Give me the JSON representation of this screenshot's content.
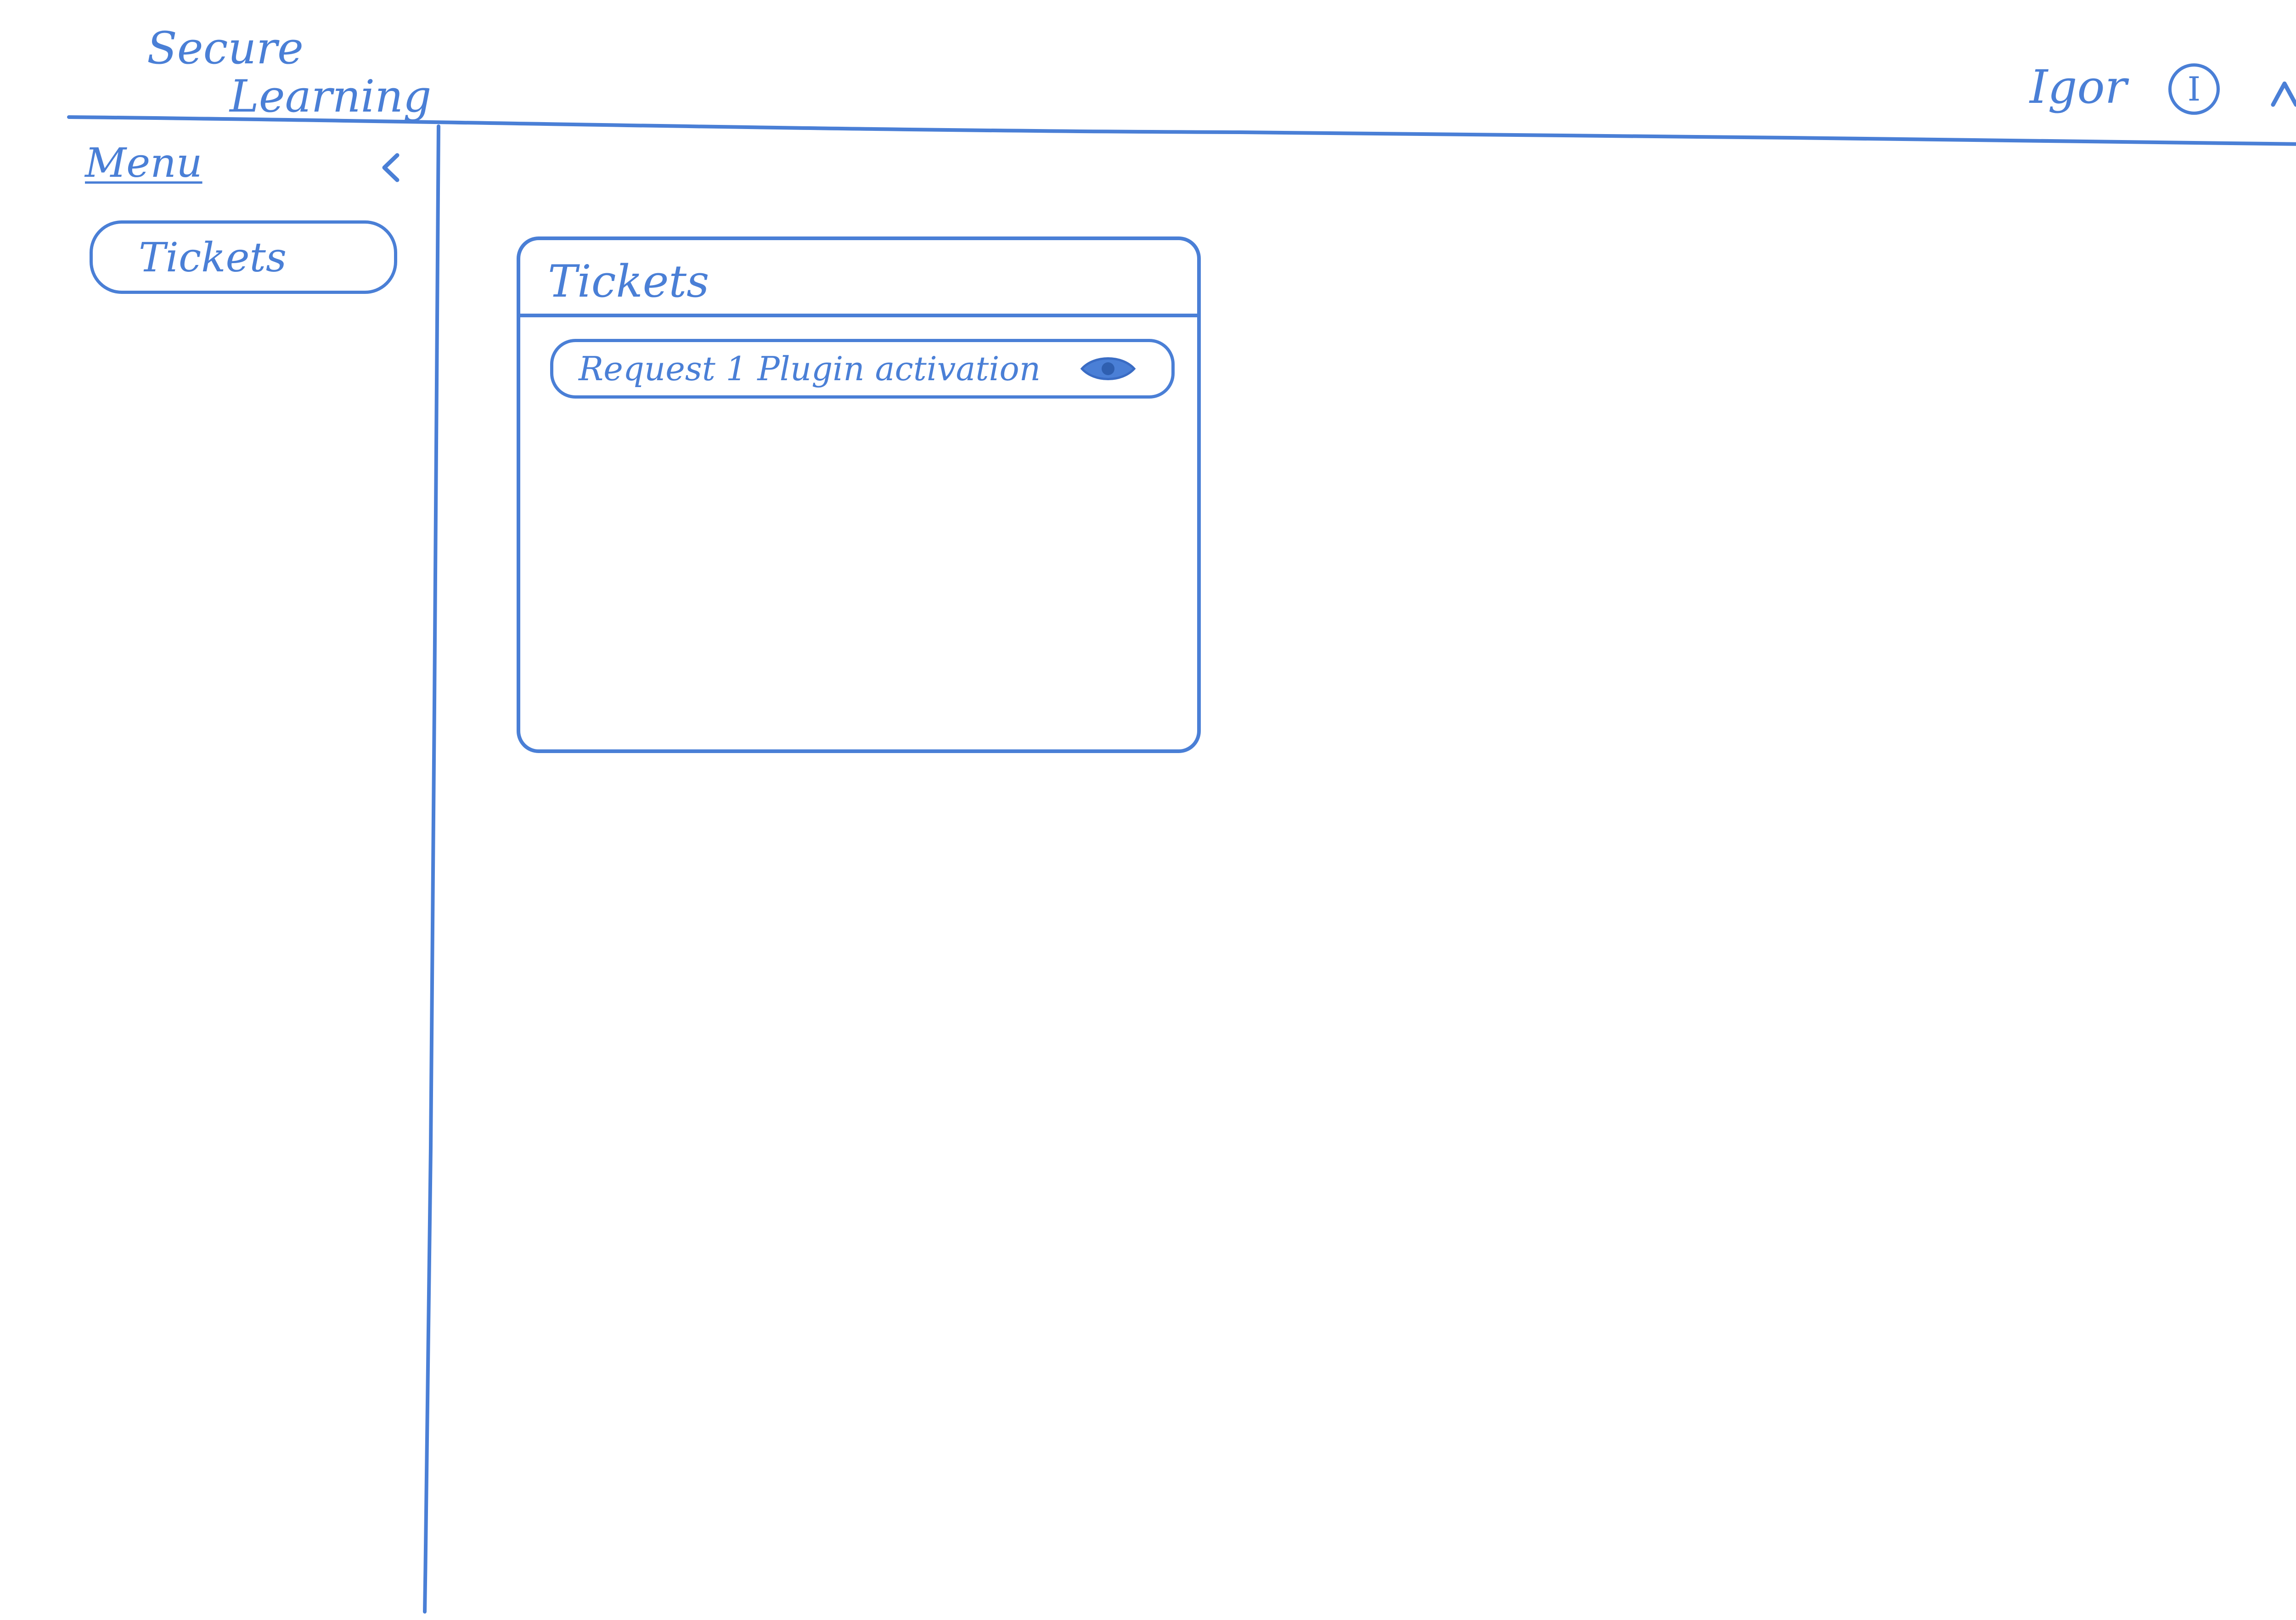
{
  "header": {
    "logo_line1": "Secure",
    "logo_line2": "Learning",
    "user_name": "Igor",
    "user_avatar_letter": "I",
    "user_menu_icon": "chevron-up-icon"
  },
  "sidebar": {
    "menu_label": "Menu",
    "collapse_icon": "chevron-left-icon",
    "items": [
      {
        "label": "Tickets"
      }
    ]
  },
  "main": {
    "tickets_panel": {
      "title": "Tickets",
      "rows": [
        {
          "label": "Request 1 Plugin activation",
          "action_icon": "eye-icon"
        }
      ]
    }
  },
  "colors": {
    "ink": "#4a7fd6",
    "background": "#ffffff"
  }
}
